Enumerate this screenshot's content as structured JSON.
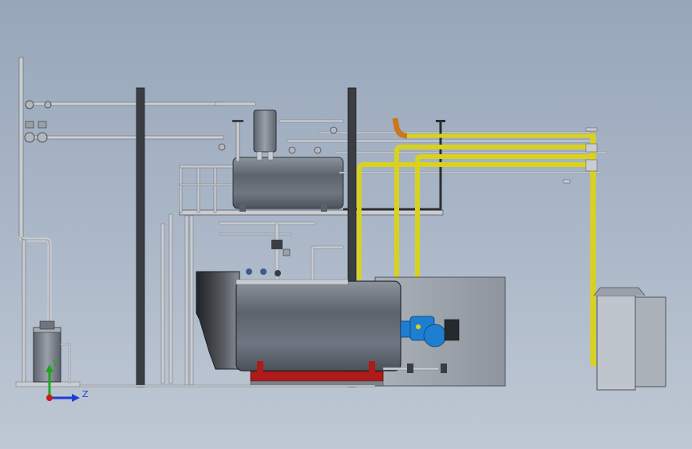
{
  "scene": {
    "description_visible_text_only": true,
    "background_top": "#97a6ba",
    "background_bottom": "#bfc8d4"
  },
  "triad": {
    "y_label": "Y",
    "z_label": "Z",
    "y_color": "#1aa81a",
    "z_color": "#1a3fd8",
    "x_color": "#d01818"
  },
  "colors": {
    "vessel": "#6c7480",
    "steel_dark": "#3a3d42",
    "pipe_gray": "#c9ccd1",
    "pipe_yellow": "#d9d21c",
    "pipe_orange": "#c9781c",
    "burner_blue": "#1e7fd0",
    "base_red": "#b01a1a",
    "panel_gray": "#9aa1aa"
  }
}
